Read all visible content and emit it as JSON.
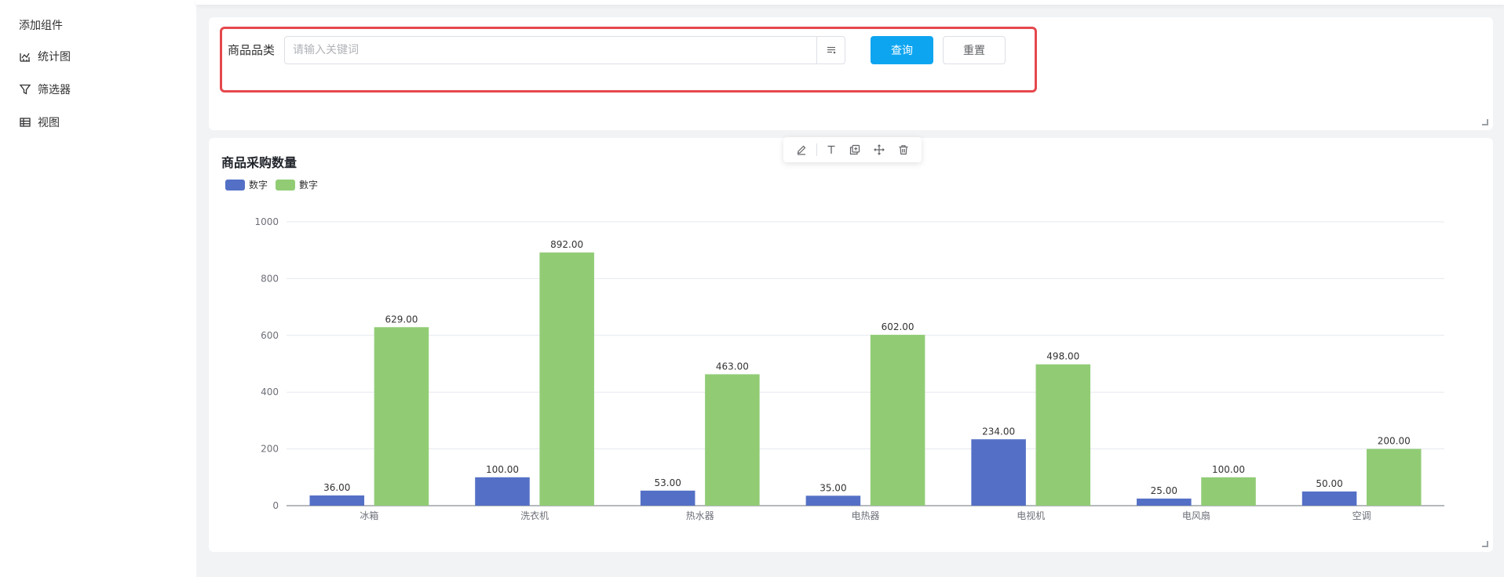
{
  "sidebar": {
    "title": "添加组件",
    "items": [
      {
        "label": "统计图",
        "icon": "chart-line-icon"
      },
      {
        "label": "筛选器",
        "icon": "filter-icon"
      },
      {
        "label": "视图",
        "icon": "table-icon"
      }
    ]
  },
  "filter": {
    "label": "商品品类",
    "placeholder": "请输入关键词",
    "query_label": "查询",
    "reset_label": "重置"
  },
  "colors": {
    "series1": "#5470c6",
    "series2": "#91cc75",
    "primary": "#0ea5f0",
    "highlight_border": "#e5484d"
  },
  "chart_data": {
    "type": "bar",
    "title": "商品采购数量",
    "categories": [
      "冰箱",
      "洗衣机",
      "热水器",
      "电热器",
      "电视机",
      "电风扇",
      "空调"
    ],
    "series": [
      {
        "name": "数字",
        "color": "#5470c6",
        "values": [
          36,
          100,
          53,
          35,
          234,
          25,
          50
        ],
        "labels": [
          "36.00",
          "100.00",
          "53.00",
          "35.00",
          "234.00",
          "25.00",
          "50.00"
        ]
      },
      {
        "name": "數字",
        "color": "#91cc75",
        "values": [
          629,
          892,
          463,
          602,
          498,
          100,
          200
        ],
        "labels": [
          "629.00",
          "892.00",
          "463.00",
          "602.00",
          "498.00",
          "100.00",
          "200.00"
        ]
      }
    ],
    "ylim": [
      0,
      1000
    ],
    "yticks": [
      "0",
      "200",
      "400",
      "600",
      "800",
      "1000"
    ],
    "grid": true,
    "legend": "top-left"
  }
}
